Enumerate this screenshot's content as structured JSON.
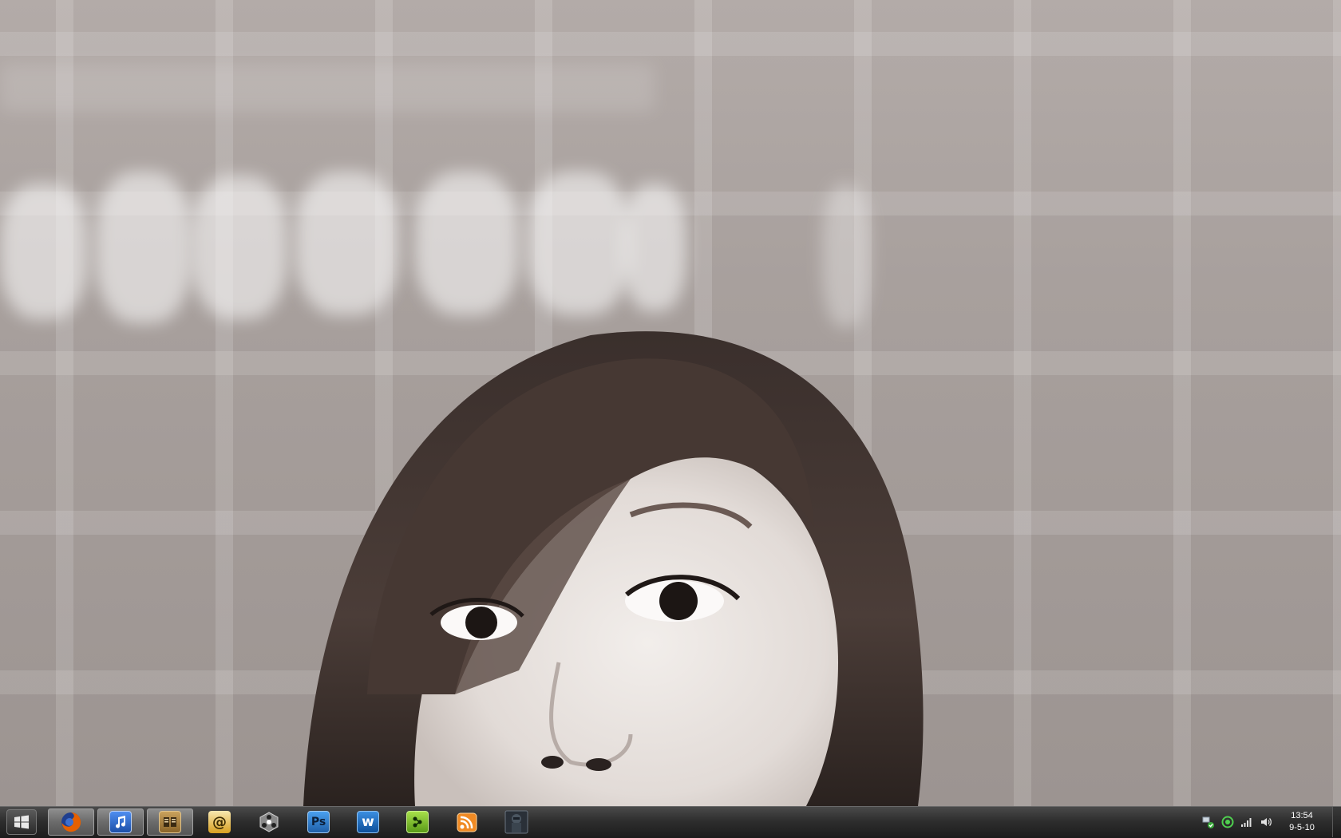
{
  "taskbar": {
    "start_button": {
      "icon": "windows-logo-icon"
    },
    "items": [
      {
        "name": "firefox",
        "icon": "firefox-icon",
        "active": true,
        "color": "#e66000"
      },
      {
        "name": "itunes",
        "icon": "itunes-note-icon",
        "active": true,
        "color": "#2f6fd6"
      },
      {
        "name": "news-reader",
        "icon": "newspaper-icon",
        "active": true,
        "color": "#a07a3a"
      },
      {
        "name": "mail",
        "icon": "at-sign-icon",
        "active": false,
        "color": "#d8a020",
        "glyph": "@"
      },
      {
        "name": "network-tool",
        "icon": "hexagon-network-icon",
        "active": false,
        "color": "#606060"
      },
      {
        "name": "photoshop",
        "icon": "photoshop-icon",
        "active": false,
        "color": "#1f5fa8",
        "glyph": "Ps"
      },
      {
        "name": "windows-live-writer",
        "icon": "writer-icon",
        "active": false,
        "color": "#1a6fc4",
        "glyph": "w"
      },
      {
        "name": "messenger",
        "icon": "green-app-icon",
        "active": false,
        "color": "#7ab82a"
      },
      {
        "name": "rss-reader",
        "icon": "rss-feed-icon",
        "active": false,
        "color": "#f08a24"
      },
      {
        "name": "game",
        "icon": "soldier-game-icon",
        "active": false,
        "color": "#334"
      }
    ],
    "tray": {
      "icons": [
        "network-status-icon",
        "green-circle-icon",
        "signal-bars-icon",
        "volume-icon"
      ],
      "time": "13:54",
      "date": "9-5-10"
    }
  }
}
